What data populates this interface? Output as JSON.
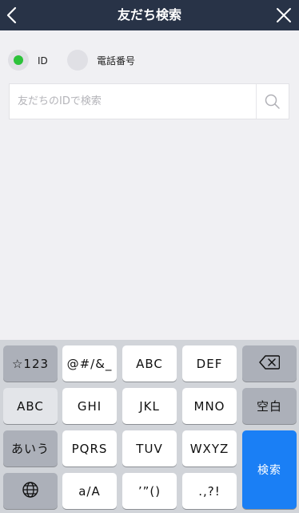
{
  "header": {
    "title": "友だち検索"
  },
  "search_type": {
    "options": [
      {
        "label": "ID",
        "selected": true
      },
      {
        "label": "電話番号",
        "selected": false
      }
    ]
  },
  "search": {
    "placeholder": "友だちのIDで検索",
    "value": ""
  },
  "keyboard": {
    "row1": [
      "☆123",
      "@#/&_",
      "ABC",
      "DEF"
    ],
    "row2": [
      "ABC",
      "GHI",
      "JKL",
      "MNO",
      "空白"
    ],
    "row3": [
      "あいう",
      "PQRS",
      "TUV",
      "WXYZ"
    ],
    "row4": [
      "a/A",
      "’”()",
      ".,?!"
    ],
    "enter": "検索"
  },
  "colors": {
    "header_bg": "#283347",
    "selected_radio": "#2cc23a",
    "enter_key": "#1a7ff5"
  }
}
